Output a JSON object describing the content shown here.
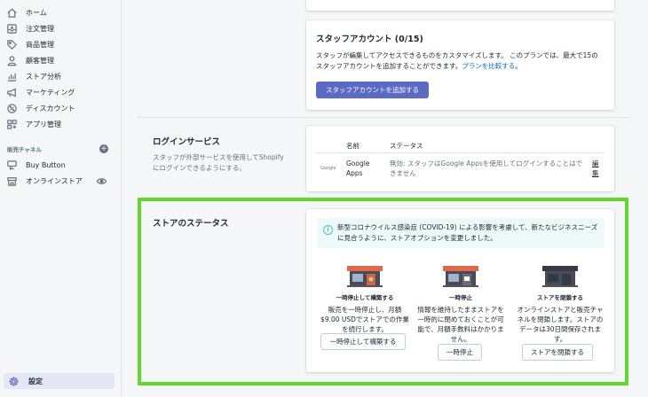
{
  "sidebar": {
    "items": [
      {
        "label": "ホーム",
        "icon": "home-icon"
      },
      {
        "label": "注文管理",
        "icon": "orders-icon"
      },
      {
        "label": "商品管理",
        "icon": "tag-icon"
      },
      {
        "label": "顧客管理",
        "icon": "customer-icon"
      },
      {
        "label": "ストア分析",
        "icon": "analytics-icon"
      },
      {
        "label": "マーケティング",
        "icon": "megaphone-icon"
      },
      {
        "label": "ディスカウント",
        "icon": "discount-icon"
      },
      {
        "label": "アプリ管理",
        "icon": "apps-icon"
      }
    ],
    "channels_title": "販売チャネル",
    "channels": [
      {
        "label": "Buy Button",
        "icon": "buy-button-icon"
      },
      {
        "label": "オンラインストア",
        "icon": "store-icon"
      }
    ],
    "settings_label": "設定"
  },
  "staff": {
    "title": "スタッフアカウント (0/15)",
    "text": "スタッフが編集してアクセスできるものをカスタマイズします。 このプランでは、最大で15のスタッフアカウントを追加することができます。",
    "link": "プランを比較する",
    "text_end": "。",
    "button": "スタッフアカウントを追加する"
  },
  "login": {
    "heading": "ログインサービス",
    "description": "スタッフが外部サービスを使用してShopifyにログインできるようにする。",
    "col_name": "名前",
    "col_status": "ステータス",
    "logo_text": "Google",
    "row_name": "Google Apps",
    "row_status": "無効: スタッフはGoogle Appsを使用してログインすることはできません",
    "row_edit": "編集"
  },
  "store_status": {
    "heading": "ストアのステータス",
    "banner": "新型コロナウイルス感染症 (COVID-19) による影響を考慮して、新たなビジネスニーズに見合うように、ストアオプションを変更しました。",
    "options": [
      {
        "title": "一時停止して構築する",
        "text": "販売を一時停止し、月額$9.00 USDでストアでの作業を続行します。",
        "button": "一時停止して構築する"
      },
      {
        "title": "一時停止",
        "text": "情報を維持したままストアを一時的に閉めておくことが可能で、月額手数料はかかりません。",
        "button": "一時停止"
      },
      {
        "title": "ストアを閉鎖する",
        "text": "オンラインストアと販売チャネルを閉鎖します。ストアのデータは30日間保存されます。",
        "button": "ストアを閉鎖する"
      }
    ]
  },
  "colors": {
    "accent": "#5c6ac4",
    "highlight": "#62d82e",
    "banner_bg": "#eef9f9"
  }
}
